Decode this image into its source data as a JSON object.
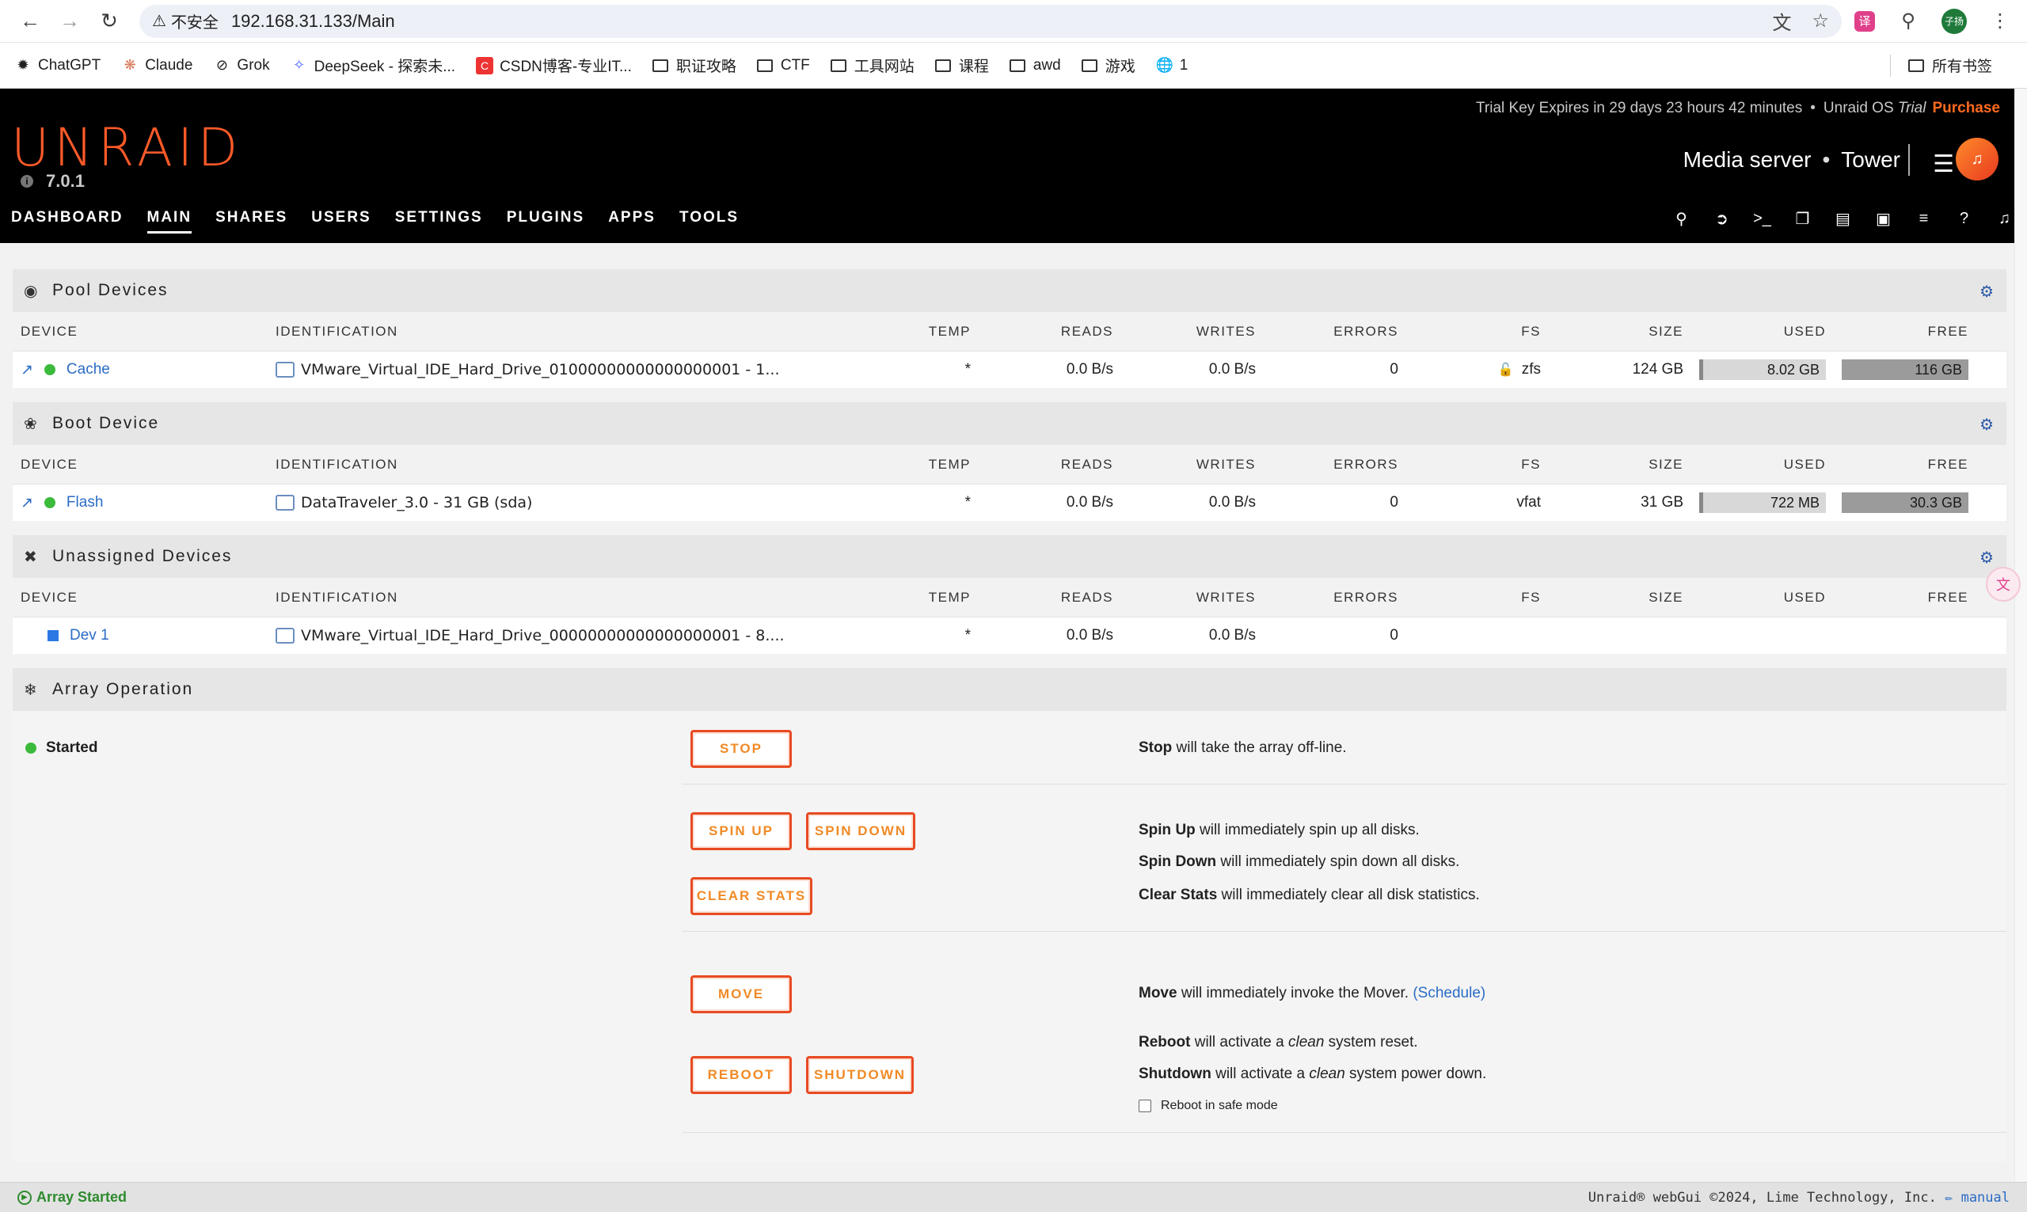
{
  "browser": {
    "insecure_label": "不安全",
    "url": "192.168.31.133/Main",
    "bookmarks": [
      "ChatGPT",
      "Claude",
      "Grok",
      "DeepSeek - 探索未...",
      "CSDN博客-专业IT..."
    ],
    "folders": [
      "职证攻略",
      "CTF",
      "工具网站",
      "课程",
      "awd",
      "游戏"
    ],
    "extra_bookmark": "1",
    "all_bookmarks": "所有书签",
    "profile_label": "子扬"
  },
  "header": {
    "trial_text": "Trial Key Expires in 29 days 23 hours 42 minutes",
    "os_label": "Unraid OS",
    "trial_word": "Trial",
    "purchase": "Purchase",
    "logo": "UNRAID",
    "version": "7.0.1",
    "server_desc": "Media server",
    "server_name": "Tower",
    "nav": [
      "DASHBOARD",
      "MAIN",
      "SHARES",
      "USERS",
      "SETTINGS",
      "PLUGINS",
      "APPS",
      "TOOLS"
    ]
  },
  "columns": [
    "DEVICE",
    "IDENTIFICATION",
    "TEMP",
    "READS",
    "WRITES",
    "ERRORS",
    "FS",
    "SIZE",
    "USED",
    "FREE"
  ],
  "pool": {
    "title": "Pool Devices",
    "row": {
      "device": "Cache",
      "id": "VMware_Virtual_IDE_Hard_Drive_01000000000000000001 - 1...",
      "temp": "*",
      "reads": "0.0 B/s",
      "writes": "0.0 B/s",
      "errors": "0",
      "fs": "zfs",
      "size": "124 GB",
      "used": "8.02 GB",
      "free": "116 GB",
      "used_fraction": 0.065
    }
  },
  "boot": {
    "title": "Boot Device",
    "row": {
      "device": "Flash",
      "id": "DataTraveler_3.0 - 31 GB (sda)",
      "temp": "*",
      "reads": "0.0 B/s",
      "writes": "0.0 B/s",
      "errors": "0",
      "fs": "vfat",
      "size": "31 GB",
      "used": "722 MB",
      "free": "30.3 GB",
      "used_fraction": 0.023
    }
  },
  "unassigned": {
    "title": "Unassigned Devices",
    "row": {
      "device": "Dev 1",
      "id": "VMware_Virtual_IDE_Hard_Drive_00000000000000000001 - 8....",
      "temp": "*",
      "reads": "0.0 B/s",
      "writes": "0.0 B/s",
      "errors": "0"
    }
  },
  "array": {
    "title": "Array Operation",
    "status": "Started",
    "buttons": {
      "stop": "STOP",
      "spin_up": "SPIN UP",
      "spin_down": "SPIN DOWN",
      "clear_stats": "CLEAR STATS",
      "move": "MOVE",
      "reboot": "REBOOT",
      "shutdown": "SHUTDOWN"
    },
    "desc": {
      "stop_b": "Stop",
      "stop_t": " will take the array off-line.",
      "spinup_b": "Spin Up",
      "spinup_t": " will immediately spin up all disks.",
      "spindown_b": "Spin Down",
      "spindown_t": " will immediately spin down all disks.",
      "clear_b": "Clear Stats",
      "clear_t": " will immediately clear all disk statistics.",
      "move_b": "Move",
      "move_t": " will immediately invoke the Mover. ",
      "move_link": "(Schedule)",
      "reboot_b": "Reboot",
      "reboot_t1": " will activate a ",
      "reboot_i": "clean",
      "reboot_t2": " system reset.",
      "shutdown_b": "Shutdown",
      "shutdown_t1": " will activate a ",
      "shutdown_i": "clean",
      "shutdown_t2": " system power down."
    },
    "safe_mode": "Reboot in safe mode"
  },
  "footer": {
    "status": "Array Started",
    "copyright": "Unraid® webGui ©2024, Lime Technology, Inc.",
    "manual": "manual"
  }
}
